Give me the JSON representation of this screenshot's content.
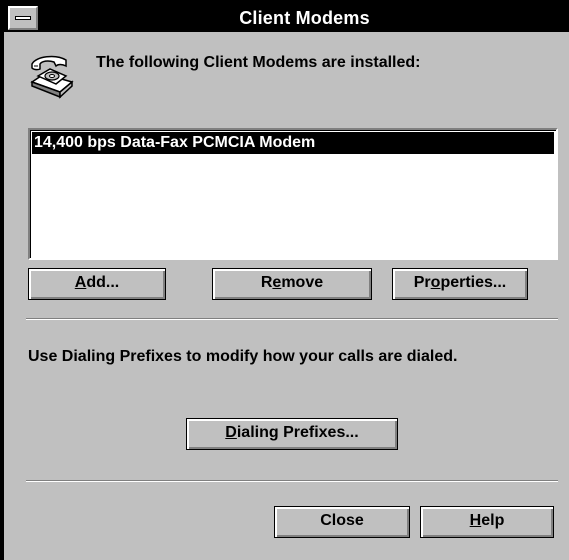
{
  "window": {
    "title": "Client Modems"
  },
  "header": {
    "text": "The following Client Modems are installed:",
    "icon": "telephone-icon"
  },
  "modems": {
    "items": [
      {
        "label": "14,400 bps Data-Fax PCMCIA Modem",
        "selected": true
      }
    ]
  },
  "buttons": {
    "add": {
      "before": "",
      "key": "A",
      "after": "dd..."
    },
    "remove": {
      "before": "R",
      "key": "e",
      "after": "move"
    },
    "properties": {
      "before": "Pr",
      "key": "o",
      "after": "perties..."
    },
    "dialing_prefixes": {
      "before": "",
      "key": "D",
      "after": "ialing Prefixes..."
    },
    "close": {
      "before": "Close",
      "key": "",
      "after": ""
    },
    "help": {
      "before": "",
      "key": "H",
      "after": "elp"
    }
  },
  "info": {
    "text": "Use Dialing Prefixes to modify how your calls are dialed."
  },
  "colors": {
    "face": "#c0c0c0",
    "titlebar": "#000000",
    "selection": "#000000"
  }
}
